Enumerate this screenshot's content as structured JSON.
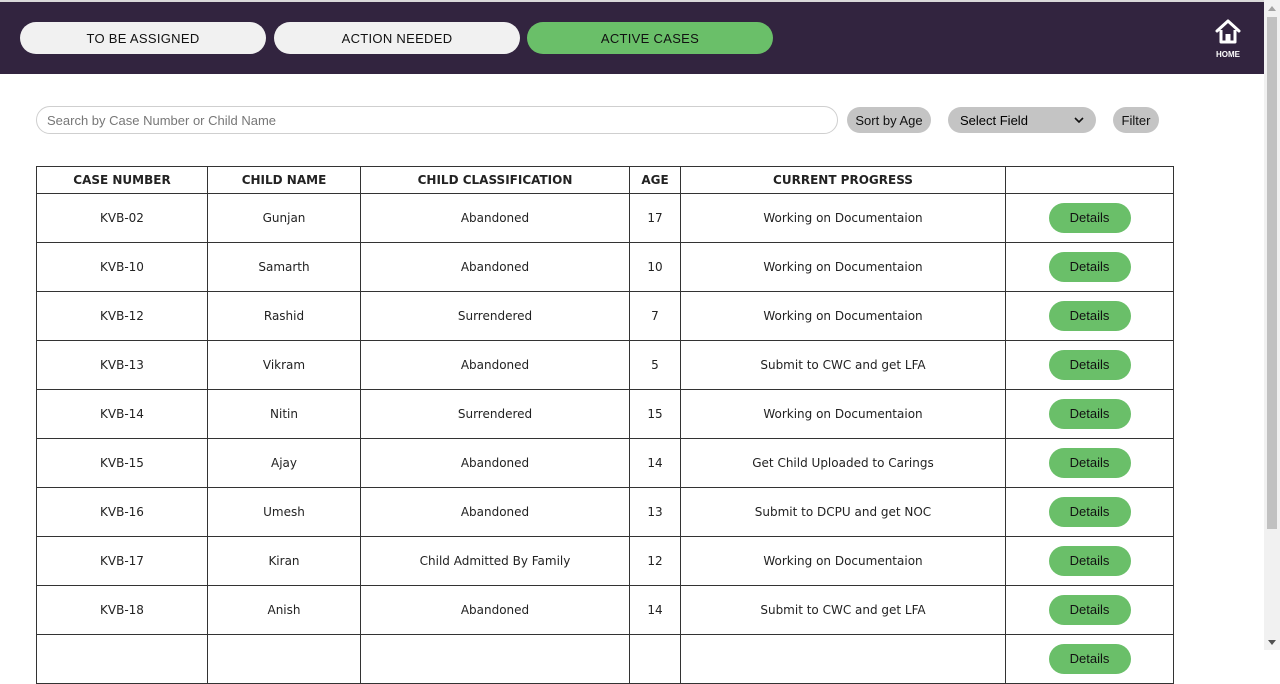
{
  "tabs": [
    {
      "label": "TO BE ASSIGNED"
    },
    {
      "label": "ACTION NEEDED"
    },
    {
      "label": "ACTIVE CASES"
    }
  ],
  "home": {
    "label": "HOME",
    "icon": "home-icon"
  },
  "search": {
    "placeholder": "Search by Case Number or Child Name"
  },
  "sort_label": "Sort by Age",
  "select_field": {
    "value": "Select Field"
  },
  "filter_label": "Filter",
  "colors": {
    "header_bg": "#32243f",
    "accent": "#6abf69",
    "grey_button": "#c4c4c4"
  },
  "table": {
    "headers": [
      "CASE NUMBER",
      "CHILD NAME",
      "CHILD CLASSIFICATION",
      "AGE",
      "CURRENT PROGRESS",
      ""
    ],
    "details_label": "Details",
    "rows": [
      {
        "case": "KVB-02",
        "name": "Gunjan",
        "classification": "Abandoned",
        "age": "17",
        "progress": "Working on Documentaion"
      },
      {
        "case": "KVB-10",
        "name": "Samarth",
        "classification": "Abandoned",
        "age": "10",
        "progress": "Working on Documentaion"
      },
      {
        "case": "KVB-12",
        "name": "Rashid",
        "classification": "Surrendered",
        "age": "7",
        "progress": "Working on Documentaion"
      },
      {
        "case": "KVB-13",
        "name": "Vikram",
        "classification": "Abandoned",
        "age": "5",
        "progress": "Submit to CWC and get LFA"
      },
      {
        "case": "KVB-14",
        "name": "Nitin",
        "classification": "Surrendered",
        "age": "15",
        "progress": "Working on Documentaion"
      },
      {
        "case": "KVB-15",
        "name": "Ajay",
        "classification": "Abandoned",
        "age": "14",
        "progress": "Get Child Uploaded to Carings"
      },
      {
        "case": "KVB-16",
        "name": "Umesh",
        "classification": "Abandoned",
        "age": "13",
        "progress": "Submit to DCPU and get NOC"
      },
      {
        "case": "KVB-17",
        "name": "Kiran",
        "classification": "Child Admitted By Family",
        "age": "12",
        "progress": "Working on Documentaion"
      },
      {
        "case": "KVB-18",
        "name": "Anish",
        "classification": "Abandoned",
        "age": "14",
        "progress": "Submit to CWC and get LFA"
      },
      {
        "case": "",
        "name": "",
        "classification": "",
        "age": "",
        "progress": ""
      }
    ]
  }
}
